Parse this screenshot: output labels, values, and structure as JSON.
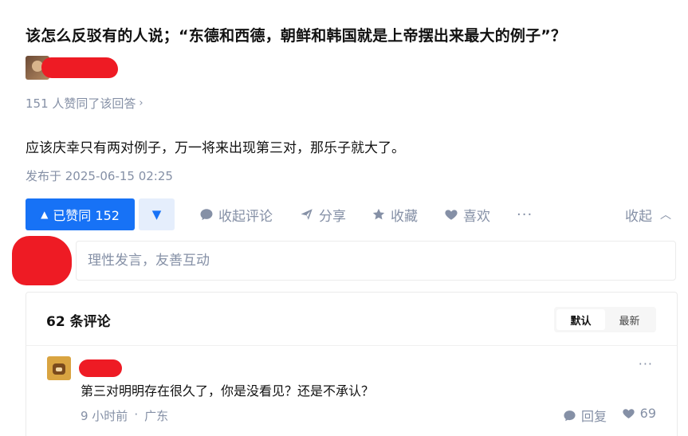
{
  "question": {
    "title": "该怎么反驳有的人说；“东德和西德，朝鲜和韩国就是上帝摆出来最大的例子”？"
  },
  "answer": {
    "vote_summary": "151 人赞同了该回答",
    "vote_summary_chevron": "›",
    "content": "应该庆幸只有两对例子，万一将来出现第三对，那乐子就大了。",
    "publish_time": "发布于 2025-06-15 02:25"
  },
  "actions": {
    "vote_up_icon": "▲",
    "vote_up_label": "已赞同 152",
    "vote_down_icon": "▼",
    "comment_label": "收起评论",
    "share_label": "分享",
    "favorite_label": "收藏",
    "like_label": "喜欢",
    "more_label": "···",
    "collapse_label": "收起",
    "collapse_chevron": "︿"
  },
  "comment_input": {
    "placeholder": "理性发言，友善互动"
  },
  "comments": {
    "count_label": "62 条评论",
    "sort_options": [
      "默认",
      "最新"
    ],
    "items": [
      {
        "text": "第三对明明存在很久了，你是没看见？还是不承认？",
        "time": "9 小时前",
        "separator": "·",
        "location": "广东",
        "more_label": "···",
        "reply_label": "回复",
        "like_count": "69"
      }
    ]
  },
  "colors": {
    "accent": "#1772f6",
    "accent_light": "#e5eefc",
    "muted": "#8590a6",
    "redaction": "#ee1b24"
  }
}
